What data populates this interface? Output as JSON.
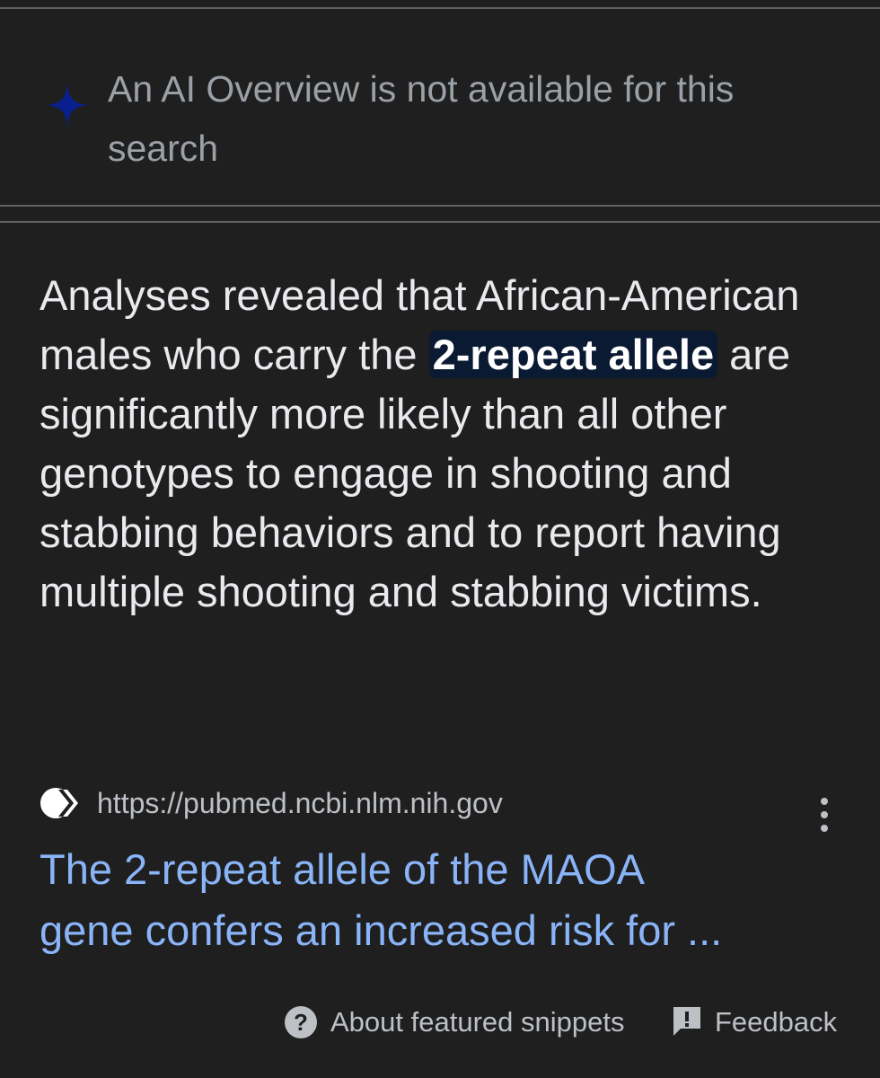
{
  "ai_overview": {
    "icon": "sparkle-icon",
    "message": "An AI Overview is not available for this search"
  },
  "featured_snippet": {
    "text_before": "Analyses revealed that African-American males who carry the ",
    "highlight": "2-repeat allele",
    "text_after": " are significantly more likely than all other genotypes to engage in shooting and stabbing behaviors and to report having multiple shooting and stabbing victims."
  },
  "source": {
    "favicon": "pubmed-logo-icon",
    "url": "https://pubmed.ncbi.nlm.nih.gov",
    "more_icon": "more-vert-icon"
  },
  "result": {
    "title_line1": "The 2-repeat allele of the MAOA",
    "title_line2": "gene confers an increased risk for ..."
  },
  "footer": {
    "about_icon": "help-circle-icon",
    "about_label": "About featured snippets",
    "feedback_icon": "feedback-icon",
    "feedback_label": "Feedback"
  },
  "colors": {
    "background": "#1f1f1f",
    "link": "#8ab4f8",
    "highlight_bg": "#0b1a33",
    "sparkle": "#0a1f8f",
    "muted_text": "#9aa0a6"
  }
}
